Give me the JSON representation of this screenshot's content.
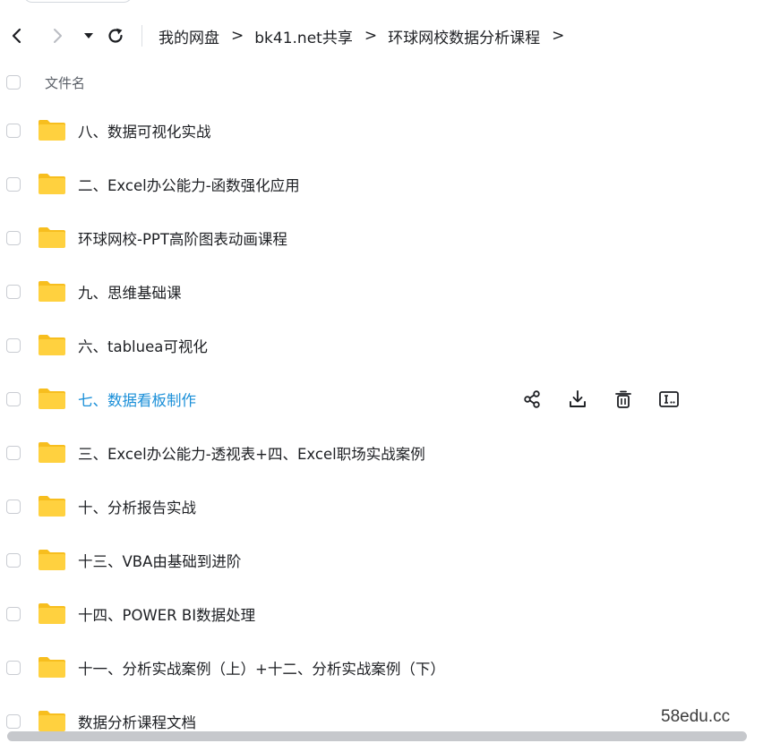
{
  "breadcrumb": [
    "我的网盘",
    "bk41.net共享",
    "环球网校数据分析课程"
  ],
  "breadcrumb_separator": ">",
  "nav_icons": {
    "back": "chevron-left-icon",
    "forward": "chevron-right-icon",
    "history": "caret-down-icon",
    "refresh": "refresh-icon"
  },
  "list": {
    "header_label": "文件名",
    "items": [
      {
        "name": "八、数据可视化实战"
      },
      {
        "name": "二、Excel办公能力-函数强化应用"
      },
      {
        "name": "环球网校-PPT高阶图表动画课程"
      },
      {
        "name": "九、思维基础课"
      },
      {
        "name": "六、tabluea可视化"
      },
      {
        "name": "七、数据看板制作",
        "hovered": true
      },
      {
        "name": "三、Excel办公能力-透视表+四、Excel职场实战案例"
      },
      {
        "name": "十、分析报告实战"
      },
      {
        "name": "十三、VBA由基础到进阶"
      },
      {
        "name": "十四、POWER BI数据处理"
      },
      {
        "name": "十一、分析实战案例（上）+十二、分析实战案例（下）"
      },
      {
        "name": "数据分析课程文档"
      }
    ]
  },
  "row_actions": [
    "share-icon",
    "download-icon",
    "delete-icon",
    "rename-icon"
  ],
  "colors": {
    "folder": "#FFD13F",
    "folder_tab": "#F7BE1E",
    "hover_text": "#1A8FD8",
    "text": "#1D1F23"
  },
  "watermark": "58edu.cc"
}
